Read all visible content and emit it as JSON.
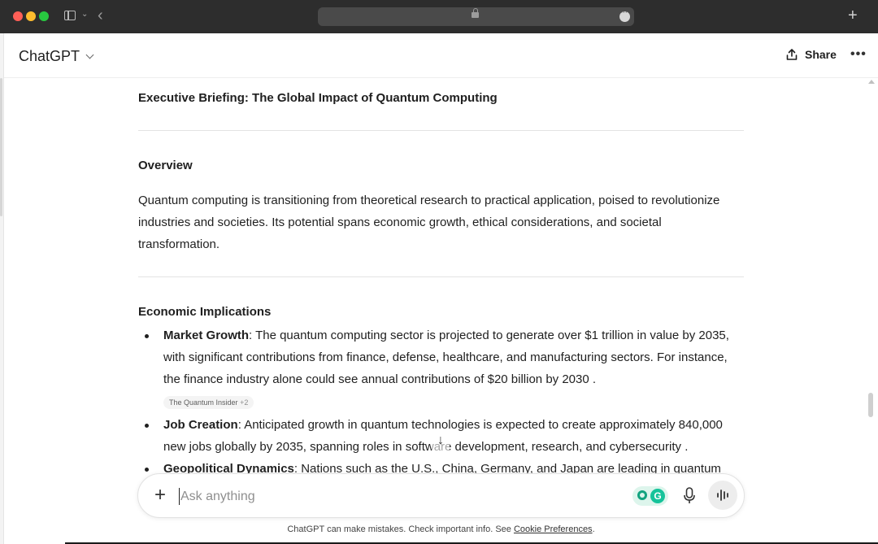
{
  "browser": {
    "icons": [
      "close-dot",
      "minimize-dot",
      "maximize-dot",
      "sidebar-icon",
      "chevron-down-icon",
      "back-icon",
      "lock-icon",
      "more-icon",
      "plus-icon"
    ],
    "colors": {
      "red": "#ff5f57",
      "yellow": "#febc2e",
      "green": "#28c840"
    }
  },
  "header": {
    "title": "ChatGPT",
    "share_label": "Share",
    "more_label": "•••"
  },
  "content": {
    "title": "Executive Briefing: The Global Impact of Quantum Computing",
    "overview_heading": "Overview",
    "overview_text": "Quantum computing is transitioning from theoretical research to practical application, poised to revolutionize industries and societies. Its potential spans economic growth, ethical considerations, and societal transformation.",
    "econ_heading": "Economic Implications",
    "bullets": [
      {
        "label": "Market Growth",
        "text": ": The quantum computing sector is projected to generate over $1 trillion in value by 2035, with significant contributions from finance, defense, healthcare, and manufacturing sectors. For instance, the finance industry alone could see annual contributions of $20 billion by 2030 ."
      },
      {
        "label": "Job Creation",
        "text": ": Anticipated growth in quantum technologies is expected to create approximately 840,000 new jobs globally by 2035, spanning roles in software development, research, and cybersecurity ."
      },
      {
        "label": "Geopolitical Dynamics",
        "text": ": Nations such as the U.S., China, Germany, and Japan are leading in quantum"
      }
    ],
    "citation_source": "The Quantum Insider",
    "citation_extra": "+2",
    "scroll_down_icon": "↓"
  },
  "composer": {
    "plus_label": "+",
    "placeholder": "Ask anything",
    "grammarly_letter": "G"
  },
  "footer": {
    "disclaimer": "ChatGPT can make mistakes. Check important info. See ",
    "cookie_link": "Cookie Preferences",
    "period": "."
  }
}
